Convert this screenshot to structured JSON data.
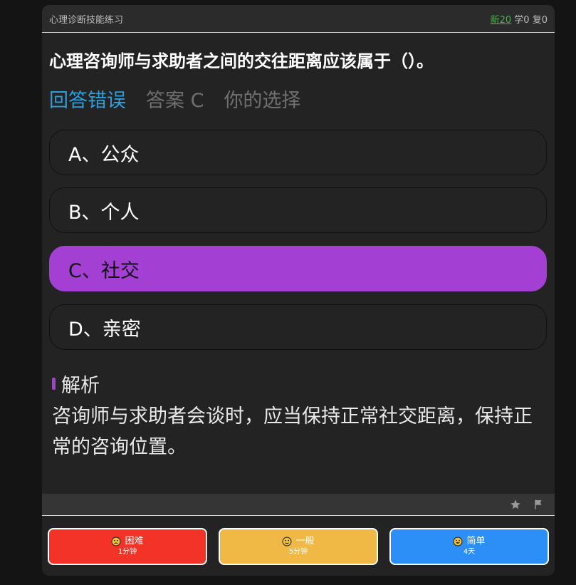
{
  "header": {
    "deck_title": "心理诊断技能练习",
    "new_count": "新20",
    "learn_count": "学0",
    "review_count": "复0"
  },
  "question": {
    "text": "心理咨询师与求助者之间的交往距离应该属于（）。"
  },
  "status": {
    "result": "回答错误",
    "answer": "答案 C",
    "your_choice": "你的选择"
  },
  "options": [
    {
      "label": "A、公众",
      "selected": false
    },
    {
      "label": "B、个人",
      "selected": false
    },
    {
      "label": "C、社交",
      "selected": true
    },
    {
      "label": "D、亲密",
      "selected": false
    }
  ],
  "explanation": {
    "title": "解析",
    "text": "咨询师与求助者会谈时，应当保持正常社交距离，保持正常的咨询位置。"
  },
  "toolbar": {
    "icons": [
      "star-icon",
      "flag-icon"
    ]
  },
  "rating": [
    {
      "label": "困难",
      "interval": "1分钟",
      "color": "#f33327",
      "icon": "frown-face-icon"
    },
    {
      "label": "一般",
      "interval": "5分钟",
      "color": "#f0b845",
      "icon": "neutral-face-icon"
    },
    {
      "label": "简单",
      "interval": "4天",
      "color": "#2b8ff7",
      "icon": "smile-face-icon"
    }
  ],
  "colors": {
    "accent": "#a43fd4",
    "result_blue": "#2b9fdc",
    "new_green": "#49b349"
  }
}
